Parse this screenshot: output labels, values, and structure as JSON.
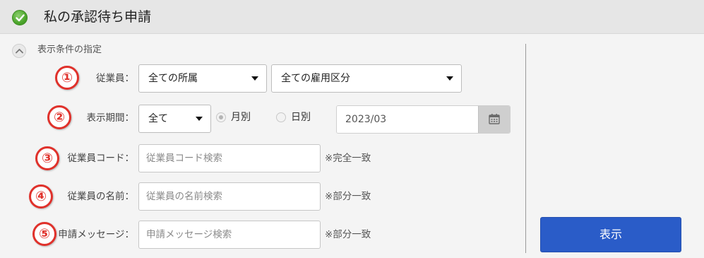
{
  "header": {
    "title": "私の承認待ち申請",
    "status_icon": "check-circle-icon"
  },
  "filter_section": {
    "title": "表示条件の指定",
    "toggle_icon": "chevron-up-icon"
  },
  "badges": [
    "①",
    "②",
    "③",
    "④",
    "⑤"
  ],
  "employee": {
    "label": "従業員：",
    "department_select": "全ての所属",
    "employment_select": "全ての雇用区分"
  },
  "period": {
    "label": "表示期間：",
    "select": "全て",
    "radio_monthly": "月別",
    "radio_daily": "日別",
    "date_value": "2023/03",
    "calendar_icon": "calendar-icon"
  },
  "employee_code": {
    "label": "従業員コード：",
    "placeholder": "従業員コード検索",
    "hint": "※完全一致"
  },
  "employee_name": {
    "label": "従業員の名前：",
    "placeholder": "従業員の名前検索",
    "hint": "※部分一致"
  },
  "message": {
    "label": "申請メッセージ：",
    "placeholder": "申請メッセージ検索",
    "hint": "※部分一致"
  },
  "actions": {
    "show_label": "表示"
  },
  "colors": {
    "primary_button": "#2a5cc8",
    "badge": "#e0312b",
    "check": "#4ba52b"
  }
}
